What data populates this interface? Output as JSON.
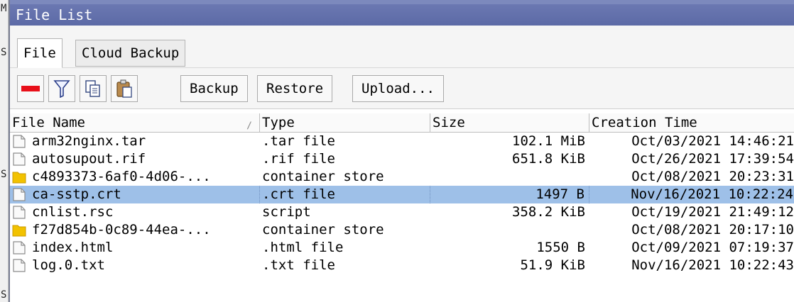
{
  "window": {
    "title": "File List"
  },
  "bg_glyphs": [
    "M",
    "S",
    "S",
    "S"
  ],
  "tabs": [
    {
      "label": "File",
      "active": true
    },
    {
      "label": "Cloud Backup",
      "active": false
    }
  ],
  "toolbar": {
    "icons": [
      "remove-icon",
      "filter-icon",
      "copy-icon",
      "paste-icon"
    ],
    "buttons": [
      "Backup",
      "Restore",
      "Upload..."
    ]
  },
  "columns": [
    "File Name",
    "Type",
    "Size",
    "Creation Time"
  ],
  "rows": [
    {
      "name": "arm32nginx.tar",
      "type": ".tar file",
      "size": "102.1 MiB",
      "time": "Oct/03/2021 14:46:21",
      "icon": "file-icon"
    },
    {
      "name": "autosupout.rif",
      "type": ".rif file",
      "size": "651.8 KiB",
      "time": "Oct/26/2021 17:39:54",
      "icon": "file-icon"
    },
    {
      "name": "c4893373-6af0-4d06-...",
      "type": "container store",
      "size": "",
      "time": "Oct/08/2021 20:23:31",
      "icon": "folder-icon"
    },
    {
      "name": "ca-sstp.crt",
      "type": ".crt file",
      "size": "1497 B",
      "time": "Nov/16/2021 10:22:24",
      "icon": "file-icon",
      "selected": true
    },
    {
      "name": "cnlist.rsc",
      "type": "script",
      "size": "358.2 KiB",
      "time": "Oct/19/2021 21:49:12",
      "icon": "file-icon"
    },
    {
      "name": "f27d854b-0c89-44ea-...",
      "type": "container store",
      "size": "",
      "time": "Oct/08/2021 20:17:10",
      "icon": "folder-icon"
    },
    {
      "name": "index.html",
      "type": ".html file",
      "size": "1550 B",
      "time": "Oct/09/2021 07:19:37",
      "icon": "file-icon"
    },
    {
      "name": "log.0.txt",
      "type": ".txt file",
      "size": "51.9 KiB",
      "time": "Nov/16/2021 10:22:43",
      "icon": "file-icon"
    }
  ]
}
